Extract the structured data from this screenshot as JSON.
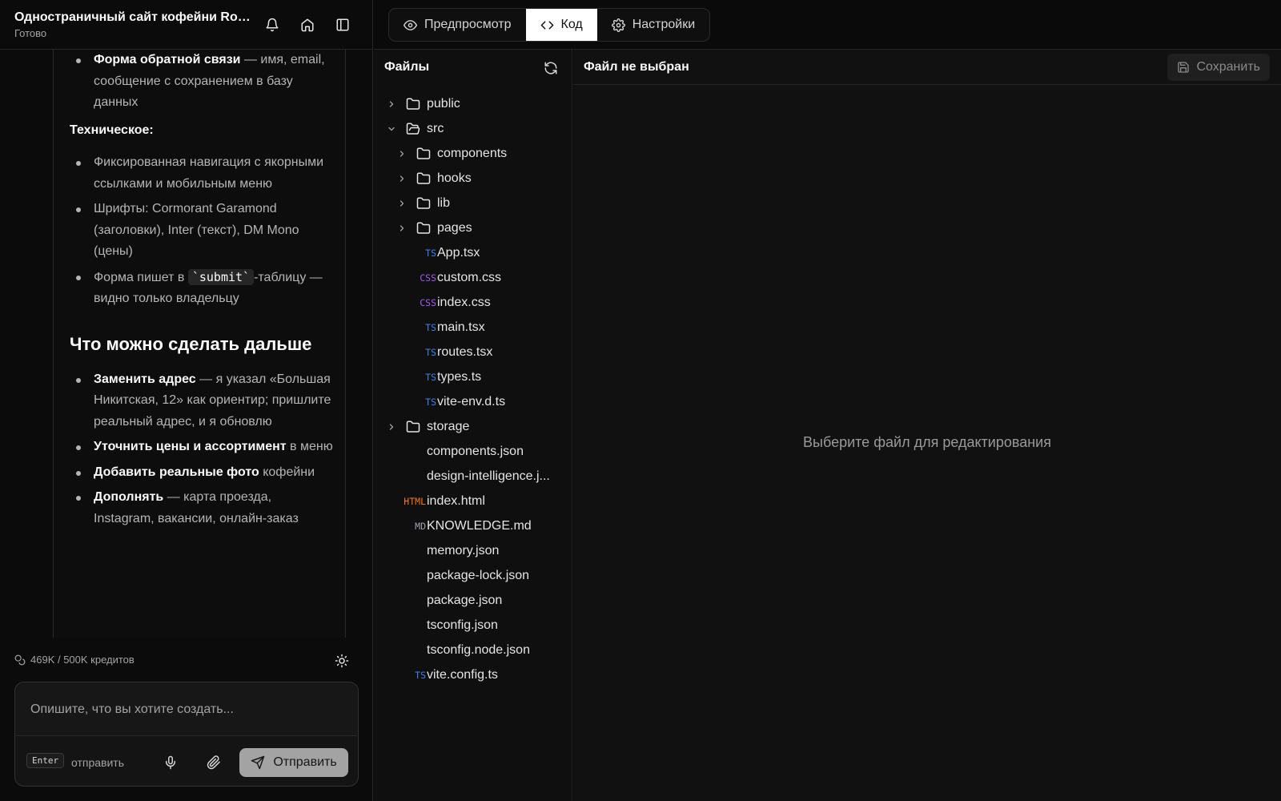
{
  "header": {
    "title": "Одностраничный сайт кофейни Roa...",
    "status": "Готово"
  },
  "message": {
    "top_item_bold": "Форма обратной связи",
    "top_item_rest": " — имя, email,",
    "top_item_line2": "сообщение с сохранением в базу данных",
    "technical_label": "Техническое:",
    "technical_items": [
      "Фиксированная навигация с якорными ссылками и мобильным меню",
      "Шрифты: Cormorant Garamond (заголовки), Inter (текст), DM Mono (цены)"
    ],
    "form_item_before": "Форма пишет в ",
    "form_item_code": "`submit`",
    "form_item_after": "-таблицу — видно только владельцу",
    "next_heading": "Что можно сделать дальше",
    "next_items": [
      {
        "bold": "Заменить адрес",
        "rest": " — я указал «Большая Никитская, 12» как ориентир; пришлите реальный адрес, и я обновлю"
      },
      {
        "bold": "Уточнить цены и ассортимент",
        "rest": " в меню"
      },
      {
        "bold": "Добавить реальные фото",
        "rest": " кофейни"
      },
      {
        "bold": "Дополнять",
        "rest": " — карта проезда, Instagram, вакансии, онлайн-заказ"
      }
    ]
  },
  "credits": "469K / 500K кредитов",
  "composer": {
    "placeholder": "Опишите, что вы хотите создать...",
    "kbd": "Enter",
    "kbd_label": "отправить",
    "send_label": "Отправить"
  },
  "tabs": [
    {
      "label": "Предпросмотр",
      "icon": "eye-icon",
      "active": false
    },
    {
      "label": "Код",
      "icon": "code-icon",
      "active": true
    },
    {
      "label": "Настройки",
      "icon": "gear-icon",
      "active": false
    }
  ],
  "files": {
    "title": "Файлы",
    "tree": [
      {
        "name": "public",
        "type": "folder",
        "open": false,
        "depth": 0
      },
      {
        "name": "src",
        "type": "folder",
        "open": true,
        "depth": 0
      },
      {
        "name": "components",
        "type": "folder",
        "open": false,
        "depth": 1
      },
      {
        "name": "hooks",
        "type": "folder",
        "open": false,
        "depth": 1
      },
      {
        "name": "lib",
        "type": "folder",
        "open": false,
        "depth": 1
      },
      {
        "name": "pages",
        "type": "folder",
        "open": false,
        "depth": 1
      },
      {
        "name": "App.tsx",
        "type": "file",
        "badge": "TS",
        "depth": 1
      },
      {
        "name": "custom.css",
        "type": "file",
        "badge": "CSS",
        "depth": 1
      },
      {
        "name": "index.css",
        "type": "file",
        "badge": "CSS",
        "depth": 1
      },
      {
        "name": "main.tsx",
        "type": "file",
        "badge": "TS",
        "depth": 1
      },
      {
        "name": "routes.tsx",
        "type": "file",
        "badge": "TS",
        "depth": 1
      },
      {
        "name": "types.ts",
        "type": "file",
        "badge": "TS",
        "depth": 1
      },
      {
        "name": "vite-env.d.ts",
        "type": "file",
        "badge": "TS",
        "depth": 1
      },
      {
        "name": "storage",
        "type": "folder",
        "open": false,
        "depth": 0
      },
      {
        "name": "components.json",
        "type": "file",
        "badge": "",
        "depth": 0
      },
      {
        "name": "design-intelligence.j...",
        "type": "file",
        "badge": "",
        "depth": 0
      },
      {
        "name": "index.html",
        "type": "file",
        "badge": "HTML",
        "depth": 0
      },
      {
        "name": "KNOWLEDGE.md",
        "type": "file",
        "badge": "MD",
        "depth": 0
      },
      {
        "name": "memory.json",
        "type": "file",
        "badge": "",
        "depth": 0
      },
      {
        "name": "package-lock.json",
        "type": "file",
        "badge": "",
        "depth": 0
      },
      {
        "name": "package.json",
        "type": "file",
        "badge": "",
        "depth": 0
      },
      {
        "name": "tsconfig.json",
        "type": "file",
        "badge": "",
        "depth": 0
      },
      {
        "name": "tsconfig.node.json",
        "type": "file",
        "badge": "",
        "depth": 0
      },
      {
        "name": "vite.config.ts",
        "type": "file",
        "badge": "TS",
        "depth": 0
      }
    ]
  },
  "editor": {
    "title": "Файл не выбран",
    "save_label": "Сохранить",
    "empty_message": "Выберите файл для редактирования"
  },
  "colors": {
    "TS": "#3b82f6",
    "CSS": "#a855f7",
    "HTML": "#f97316",
    "MD": "#9ca3af"
  }
}
